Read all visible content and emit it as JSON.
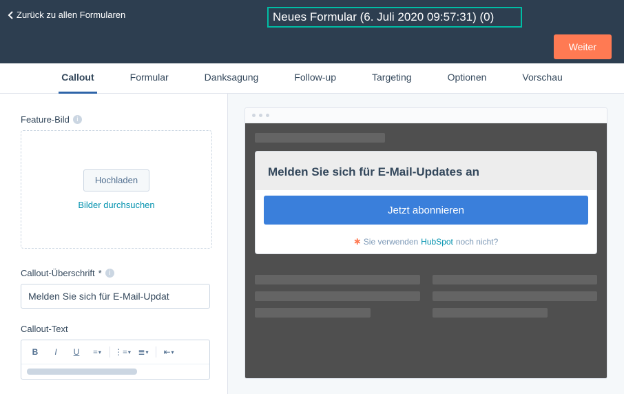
{
  "topbar": {
    "back_label": "Zurück zu allen Formularen",
    "title_value": "Neues Formular (6. Juli 2020 09:57:31) (0)",
    "next_label": "Weiter"
  },
  "tabs": [
    {
      "label": "Callout",
      "active": true
    },
    {
      "label": "Formular",
      "active": false
    },
    {
      "label": "Danksagung",
      "active": false
    },
    {
      "label": "Follow-up",
      "active": false
    },
    {
      "label": "Targeting",
      "active": false
    },
    {
      "label": "Optionen",
      "active": false
    },
    {
      "label": "Vorschau",
      "active": false
    }
  ],
  "sidebar": {
    "feature_image_label": "Feature-Bild",
    "upload_button": "Hochladen",
    "browse_link": "Bilder durchsuchen",
    "headline_label": "Callout-Überschrift",
    "headline_required_mark": "*",
    "headline_value": "Melden Sie sich für E-Mail-Updat",
    "text_label": "Callout-Text"
  },
  "preview": {
    "popup_title": "Melden Sie sich für E-Mail-Updates an",
    "cta_label": "Jetzt abonnieren",
    "footer_prefix": "Sie verwenden",
    "footer_brand": "HubSpot",
    "footer_suffix": "noch nicht?"
  }
}
